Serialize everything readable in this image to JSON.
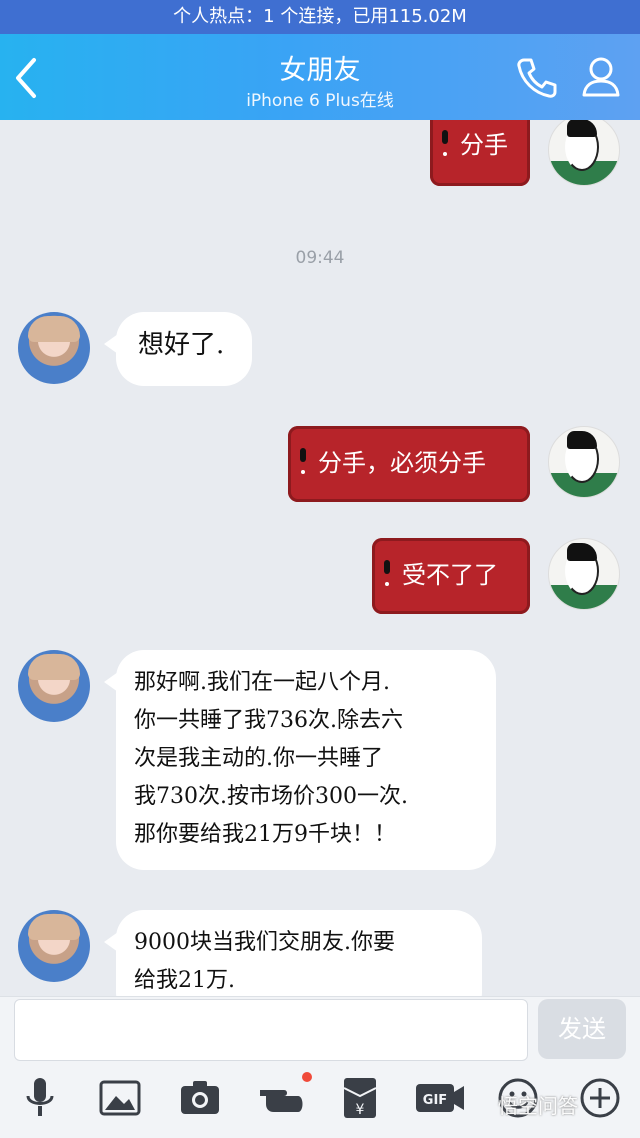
{
  "status": {
    "hotspot_text": "个人热点：1 个连接，已用115.02M"
  },
  "header": {
    "title": "女朋友",
    "subtitle": "iPhone 6 Plus在线",
    "back_icon": "chevron-left-icon",
    "call_icon": "phone-icon",
    "profile_icon": "person-icon"
  },
  "chat": {
    "timestamp": "09:44",
    "messages": [
      {
        "from": "me",
        "text": "分手"
      },
      {
        "from": "her",
        "text": "想好了."
      },
      {
        "from": "me",
        "text": "分手，必须分手"
      },
      {
        "from": "me",
        "text": "受不了了"
      },
      {
        "from": "her",
        "lines": [
          "那好啊.我们在一起八个月.",
          "你一共睡了我736次.除去六",
          "次是我主动的.你一共睡了",
          "我730次.按市场价300一次.",
          "那你要给我21万9千块！！"
        ]
      },
      {
        "from": "her",
        "lines": [
          "9000块当我们交朋友.你要",
          "给我21万."
        ]
      }
    ]
  },
  "input": {
    "value": "",
    "send_label": "发送"
  },
  "toolbar": {
    "icons": [
      "microphone-icon",
      "image-icon",
      "camera-icon",
      "hand-icon",
      "red-packet-icon",
      "gif-icon",
      "emoji-icon",
      "more-icon"
    ]
  },
  "watermark": "悟空问答",
  "colors": {
    "navbar": "#3aa3f5",
    "bubble_out": "#b7242a",
    "badge": "#f04a3a"
  }
}
